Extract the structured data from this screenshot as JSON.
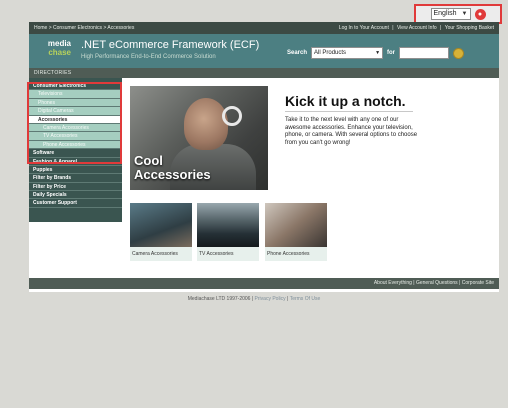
{
  "language": {
    "selected": "English",
    "go_label": "●"
  },
  "topbar": {
    "breadcrumb": "Home > Consumer Electronics > Accessories",
    "links": [
      "Log In to Your Account",
      "|",
      "View Account Info",
      "|",
      "Your Shopping Basket"
    ]
  },
  "header": {
    "logo_line1": "media",
    "logo_line2": "chase",
    "title": ".NET eCommerce Framework (ECF)",
    "subtitle": "High Performance End-to-End Commerce Solution"
  },
  "search": {
    "label": "Search",
    "category": "All Products",
    "for_label": "for"
  },
  "directories_label": "DIRECTORIES",
  "sidebar": {
    "items": [
      {
        "label": "Consumer Electronics",
        "level": "main"
      },
      {
        "label": "Televisions",
        "level": "sub"
      },
      {
        "label": "Phones",
        "level": "sub"
      },
      {
        "label": "Digital Cameras",
        "level": "sub"
      },
      {
        "label": "Accessories",
        "level": "active"
      },
      {
        "label": "Camera Accessories",
        "level": "subsub"
      },
      {
        "label": "TV Accessories",
        "level": "subsub"
      },
      {
        "label": "Phone Accessories",
        "level": "subsub"
      },
      {
        "label": "Software",
        "level": "main"
      },
      {
        "label": "Fashion & Apparel",
        "level": "main"
      },
      {
        "label": "Puppies",
        "level": "main"
      },
      {
        "label": "Filter by Brands",
        "level": "main"
      },
      {
        "label": "Filter by Price",
        "level": "main"
      },
      {
        "label": "Daily Specials",
        "level": "main"
      },
      {
        "label": "Customer Support",
        "level": "main"
      }
    ]
  },
  "hero": {
    "caption_line1": "Cool",
    "caption_line2": "Accessories",
    "headline": "Kick it up a notch.",
    "body": "Take it to the next level with any one of our awesome accessories. Enhance your television, phone, or camera. With several options to choose from you can't go wrong!"
  },
  "thumbnails": [
    {
      "label": "Camera Accessories"
    },
    {
      "label": "TV Accessories"
    },
    {
      "label": "Phone Accessories"
    }
  ],
  "footer": {
    "links": "About Everything | General Questions | Corporate Site",
    "copyright": "Mediachase LTD 1997-2006 |",
    "privacy": "Privacy Policy",
    "sep": "|",
    "terms": "Terms Of Use"
  },
  "colors": {
    "accent": "#4c7f82",
    "highlight": "#e03a3a",
    "sidebar": "#3a5550"
  }
}
